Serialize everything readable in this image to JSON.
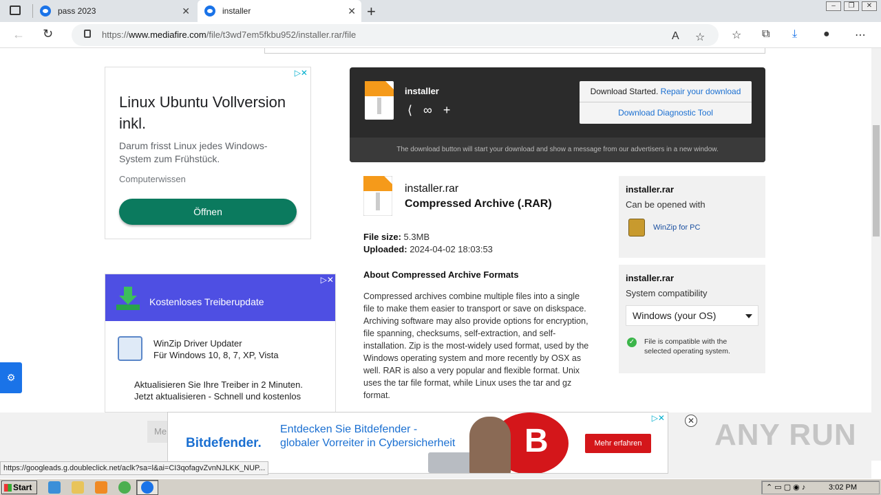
{
  "browser": {
    "tabs": [
      {
        "title": "pass 2023",
        "active": false
      },
      {
        "title": "installer",
        "active": true
      }
    ],
    "url": {
      "prefix": "https://",
      "host": "www.mediafire.com",
      "path": "/file/t3wd7em5fkbu952/installer.rar/file"
    },
    "status_url": "https://googleads.g.doubleclick.net/aclk?sa=l&ai=CI3qofagvZvnNJLKK_NUP..."
  },
  "ad_left": {
    "headline": "Linux Ubuntu Vollversion inkl.",
    "body": "Darum frisst Linux jedes Windows-System zum Frühstück.",
    "source": "Computerwissen",
    "button": "Öffnen"
  },
  "ad_driver": {
    "header": "Kostenloses Treiberupdate",
    "product_name": "WinZip Driver Updater",
    "product_sub": "Für Windows 10, 8, 7, XP, Vista",
    "desc_line1": "Aktualisieren Sie Ihre Treiber in 2 Minuten.",
    "desc_line2": "Jetzt aktualisieren - Schnell und kostenlos"
  },
  "download_box": {
    "filename": "installer",
    "status_prefix": "Download Started.",
    "repair_link": "Repair your download",
    "diagnostic_link": "Download Diagnostic Tool",
    "note": "The download button will start your download and show a message from our advertisers in a new window."
  },
  "file_info": {
    "name": "installer.rar",
    "type": "Compressed Archive (.RAR)",
    "size_label": "File size:",
    "size": "5.3MB",
    "uploaded_label": "Uploaded:",
    "uploaded": "2024-04-02 18:03:53",
    "about_title": "About Compressed Archive Formats",
    "about_text": "Compressed archives combine multiple files into a single file to make them easier to transport or save on diskspace. Archiving software may also provide options for encryption, file spanning, checksums, self-extraction, and self-installation. Zip is the most-widely used format, used by the Windows operating system and more recently by OSX as well. RAR is also a very popular and flexible format. Unix uses the tar file format, while Linux uses the tar and gz format."
  },
  "side_open": {
    "title": "installer.rar",
    "subtitle": "Can be opened with",
    "app": "WinZip for PC"
  },
  "side_compat": {
    "title": "installer.rar",
    "subtitle": "System compatibility",
    "os_selected": "Windows (your OS)",
    "compat_text": "File is compatible with the selected operating system."
  },
  "bottom_ad": {
    "brand": "Bitdefender.",
    "text": "Entdecken Sie Bitdefender - globaler Vorreiter in Cybersicherheit",
    "cta": "Mehr erfahren",
    "partial_button": "Me"
  },
  "watermark": "ANY RUN",
  "taskbar": {
    "start": "Start",
    "clock": "3:02 PM"
  }
}
